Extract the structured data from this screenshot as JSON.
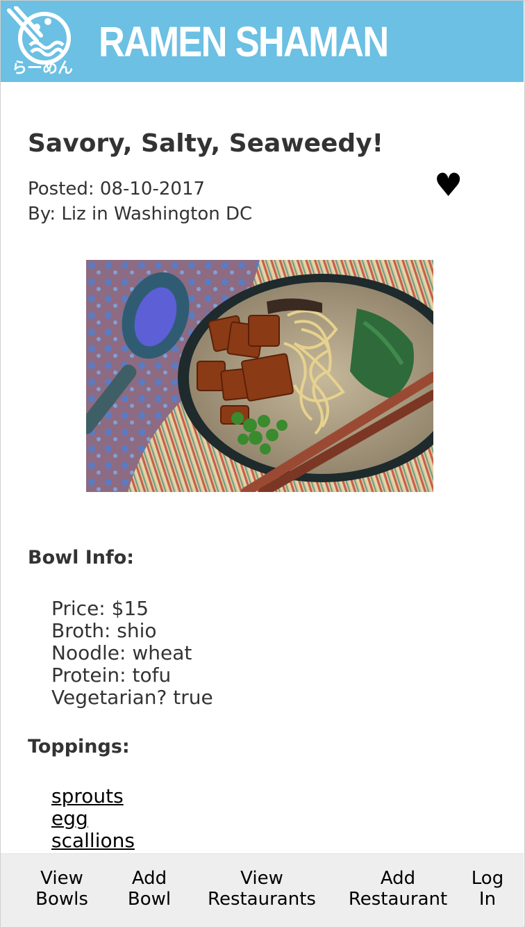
{
  "header": {
    "logo_text": "らーめん",
    "title": "RAMEN SHAMAN"
  },
  "post": {
    "title": "Savory, Salty, Seaweedy!",
    "posted": "Posted: 08-10-2017",
    "by": "By: Liz in Washington DC",
    "favorite_icon": "heart-icon",
    "favorite_glyph": "♥"
  },
  "bowl_info": {
    "heading": "Bowl Info:",
    "price": "Price: $15",
    "broth": "Broth: shio",
    "noodle": "Noodle: wheat",
    "protein": "Protein: tofu",
    "vegetarian": "Vegetarian? true"
  },
  "toppings": {
    "heading": "Toppings:",
    "items": [
      "sprouts",
      "egg",
      "scallions"
    ]
  },
  "nav": {
    "view_bowls": [
      "View",
      "Bowls"
    ],
    "add_bowl": [
      "Add",
      "Bowl"
    ],
    "view_restaurants": [
      "View",
      "Restaurants"
    ],
    "add_restaurant": [
      "Add",
      "Restaurant"
    ],
    "log_in": [
      "Log",
      "In"
    ]
  },
  "colors": {
    "header_bg": "#6bc0e3",
    "nav_bg": "#eeeeee",
    "text": "#333333"
  }
}
